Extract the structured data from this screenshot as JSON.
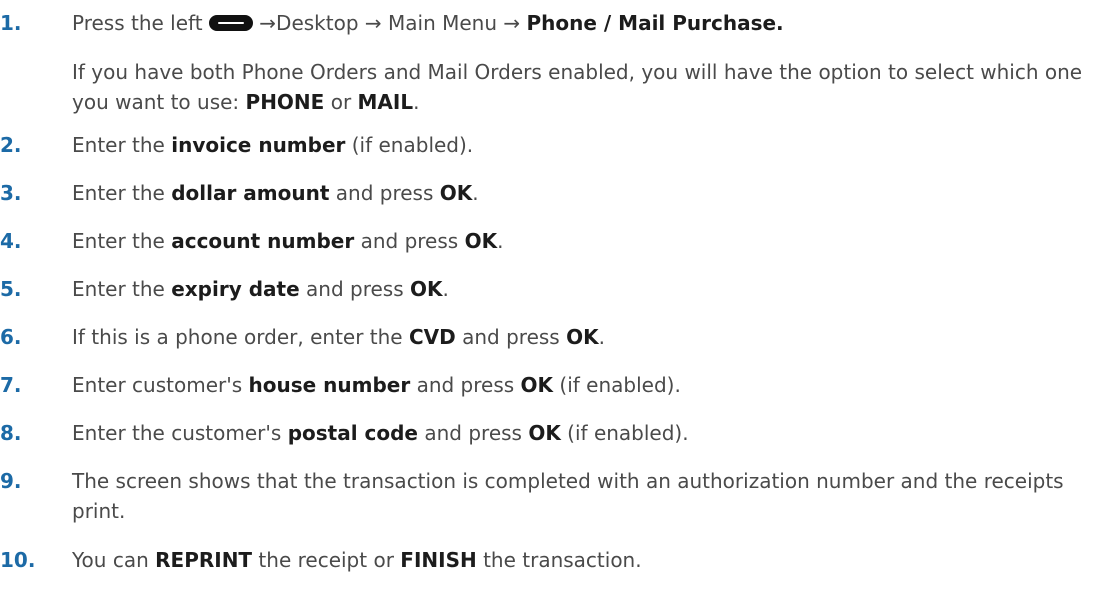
{
  "steps": [
    {
      "num": "1.",
      "parts": [
        {
          "t": "Press the left ",
          "b": false
        },
        {
          "icon": "menu-key-icon"
        },
        {
          "t": " →Desktop → Main Menu → ",
          "b": false
        },
        {
          "t": "Phone / Mail Purchase.",
          "b": true
        }
      ],
      "note_parts": [
        {
          "t": "If you have both Phone Orders and Mail Orders enabled, you will have the option to select which one you want to use: ",
          "b": false
        },
        {
          "t": "PHONE",
          "b": true
        },
        {
          "t": " or ",
          "b": false
        },
        {
          "t": "MAIL",
          "b": true
        },
        {
          "t": ".",
          "b": false
        }
      ]
    },
    {
      "num": "2.",
      "parts": [
        {
          "t": "Enter the ",
          "b": false
        },
        {
          "t": "invoice number",
          "b": true
        },
        {
          "t": " (if enabled).",
          "b": false
        }
      ]
    },
    {
      "num": "3.",
      "parts": [
        {
          "t": "Enter the ",
          "b": false
        },
        {
          "t": "dollar amount",
          "b": true
        },
        {
          "t": " and press ",
          "b": false
        },
        {
          "t": "OK",
          "b": true
        },
        {
          "t": ".",
          "b": false
        }
      ]
    },
    {
      "num": "4.",
      "parts": [
        {
          "t": "Enter the ",
          "b": false
        },
        {
          "t": "account number",
          "b": true
        },
        {
          "t": " and press ",
          "b": false
        },
        {
          "t": "OK",
          "b": true
        },
        {
          "t": ".",
          "b": false
        }
      ]
    },
    {
      "num": "5.",
      "parts": [
        {
          "t": "Enter the ",
          "b": false
        },
        {
          "t": "expiry date",
          "b": true
        },
        {
          "t": " and press ",
          "b": false
        },
        {
          "t": "OK",
          "b": true
        },
        {
          "t": ".",
          "b": false
        }
      ]
    },
    {
      "num": "6.",
      "parts": [
        {
          "t": "If this is a phone order, enter the ",
          "b": false
        },
        {
          "t": "CVD",
          "b": true
        },
        {
          "t": " and press ",
          "b": false
        },
        {
          "t": "OK",
          "b": true
        },
        {
          "t": ".",
          "b": false
        }
      ]
    },
    {
      "num": "7.",
      "parts": [
        {
          "t": "Enter customer's ",
          "b": false
        },
        {
          "t": "house number",
          "b": true
        },
        {
          "t": " and press ",
          "b": false
        },
        {
          "t": "OK",
          "b": true
        },
        {
          "t": " (if enabled).",
          "b": false
        }
      ]
    },
    {
      "num": "8.",
      "parts": [
        {
          "t": "Enter the customer's ",
          "b": false
        },
        {
          "t": "postal code",
          "b": true
        },
        {
          "t": " and press ",
          "b": false
        },
        {
          "t": "OK",
          "b": true
        },
        {
          "t": " (if enabled).",
          "b": false
        }
      ]
    },
    {
      "num": "9.",
      "parts": [
        {
          "t": "The screen shows that the transaction is completed with an authorization number and the receipts print.",
          "b": false
        }
      ]
    },
    {
      "num": "10.",
      "parts": [
        {
          "t": "You can ",
          "b": false
        },
        {
          "t": "REPRINT",
          "b": true
        },
        {
          "t": " the receipt or ",
          "b": false
        },
        {
          "t": "FINISH",
          "b": true
        },
        {
          "t": " the transaction.",
          "b": false
        }
      ]
    }
  ],
  "colors": {
    "number": "#1c6aa6",
    "text": "#4a4a4a",
    "bold": "#1c1c1c"
  }
}
